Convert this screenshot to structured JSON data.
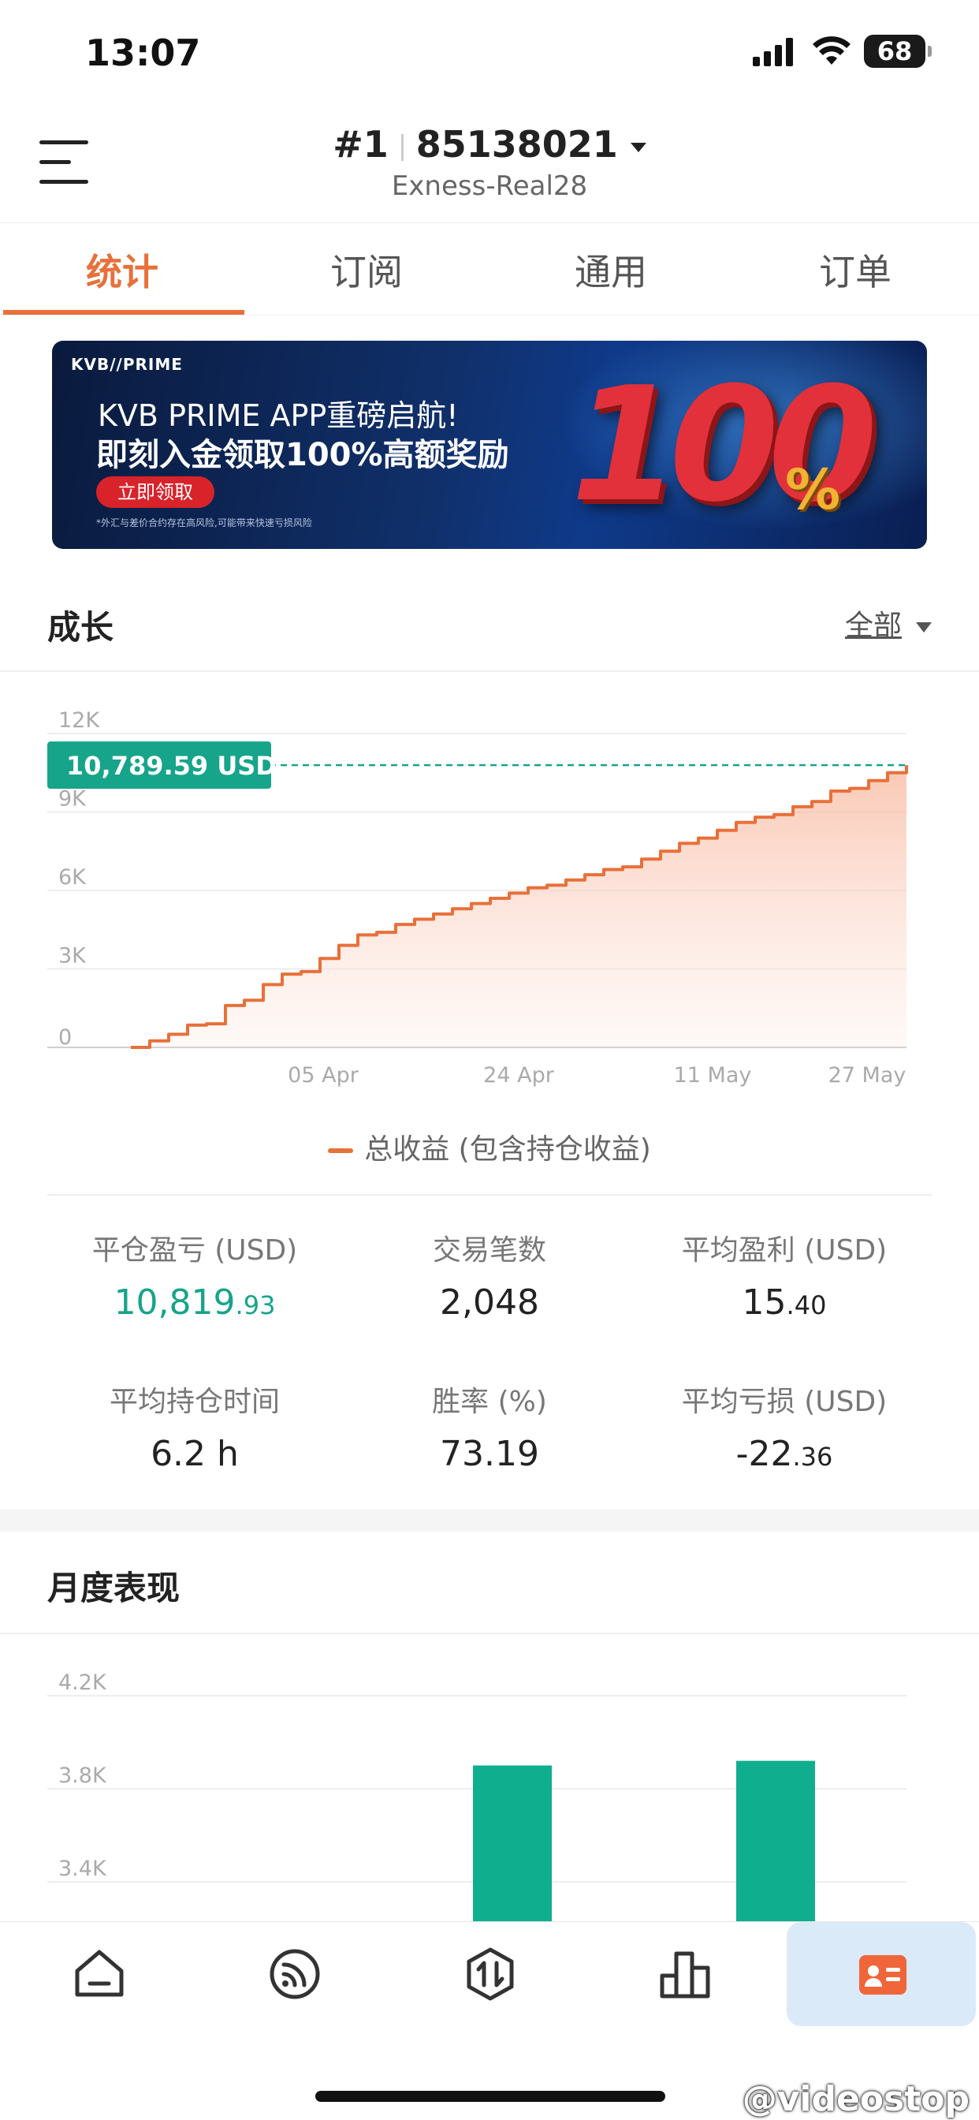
{
  "status_bar": {
    "time": "13:07",
    "battery": "68"
  },
  "header": {
    "account_rank": "#1",
    "account_number": "85138021",
    "server": "Exness-Real28"
  },
  "tabs": [
    {
      "label": "统计"
    },
    {
      "label": "订阅"
    },
    {
      "label": "通用"
    },
    {
      "label": "订单"
    }
  ],
  "banner": {
    "logo": "KVB//PRIME",
    "title": "KVB PRIME APP重磅启航!",
    "subtitle": "即刻入金领取100%高额奖励",
    "button": "立即领取",
    "note": "*外汇与差价合约存在高风险,可能带来快速亏损风险",
    "big_number": "100",
    "big_percent": "%"
  },
  "growth": {
    "title": "成长",
    "range": "全部",
    "current_label": "10,789.59 USD",
    "legend": "总收益 (包含持仓收益)"
  },
  "chart_data": [
    {
      "type": "area",
      "y_ticks": [
        "0",
        "3K",
        "6K",
        "9K",
        "12K"
      ],
      "ylim": [
        0,
        12000
      ],
      "x_ticks": [
        "05 Apr",
        "24 Apr",
        "11 May",
        "27 May"
      ],
      "series": [
        {
          "name": "总收益 (包含持仓收益)",
          "color": "#e8703a",
          "values": [
            0,
            250,
            500,
            850,
            900,
            1600,
            1800,
            2400,
            2800,
            2900,
            3400,
            3900,
            4300,
            4400,
            4700,
            4900,
            5100,
            5300,
            5500,
            5700,
            5900,
            6100,
            6200,
            6400,
            6600,
            6800,
            6900,
            7200,
            7500,
            7800,
            8000,
            8300,
            8600,
            8800,
            8900,
            9200,
            9400,
            9800,
            9900,
            10200,
            10500,
            10789.59
          ]
        }
      ],
      "reference_line": 10789.59
    },
    {
      "type": "bar",
      "y_ticks": [
        "4.2K",
        "3.8K",
        "3.4K"
      ],
      "bar_color": "#0eae8e",
      "values": [
        3900,
        3920
      ]
    }
  ],
  "stats": [
    {
      "label": "平仓盈亏 (USD)",
      "value": "10,819",
      "decimals": ".93",
      "color": "green"
    },
    {
      "label": "交易笔数",
      "value": "2,048",
      "decimals": ""
    },
    {
      "label": "平均盈利 (USD)",
      "value": "15",
      "decimals": ".40"
    },
    {
      "label": "平均持仓时间",
      "value": "6.2 h",
      "decimals": ""
    },
    {
      "label": "胜率 (%)",
      "value": "73.19",
      "decimals": ""
    },
    {
      "label": "平均亏损 (USD)",
      "value": "-22",
      "decimals": ".36"
    }
  ],
  "monthly": {
    "title": "月度表现"
  },
  "nav": [
    {
      "icon": "home-icon"
    },
    {
      "icon": "signal-feed-icon"
    },
    {
      "icon": "trade-icon"
    },
    {
      "icon": "chart-bars-icon"
    },
    {
      "icon": "account-card-icon"
    }
  ],
  "watermark": "@videostop"
}
